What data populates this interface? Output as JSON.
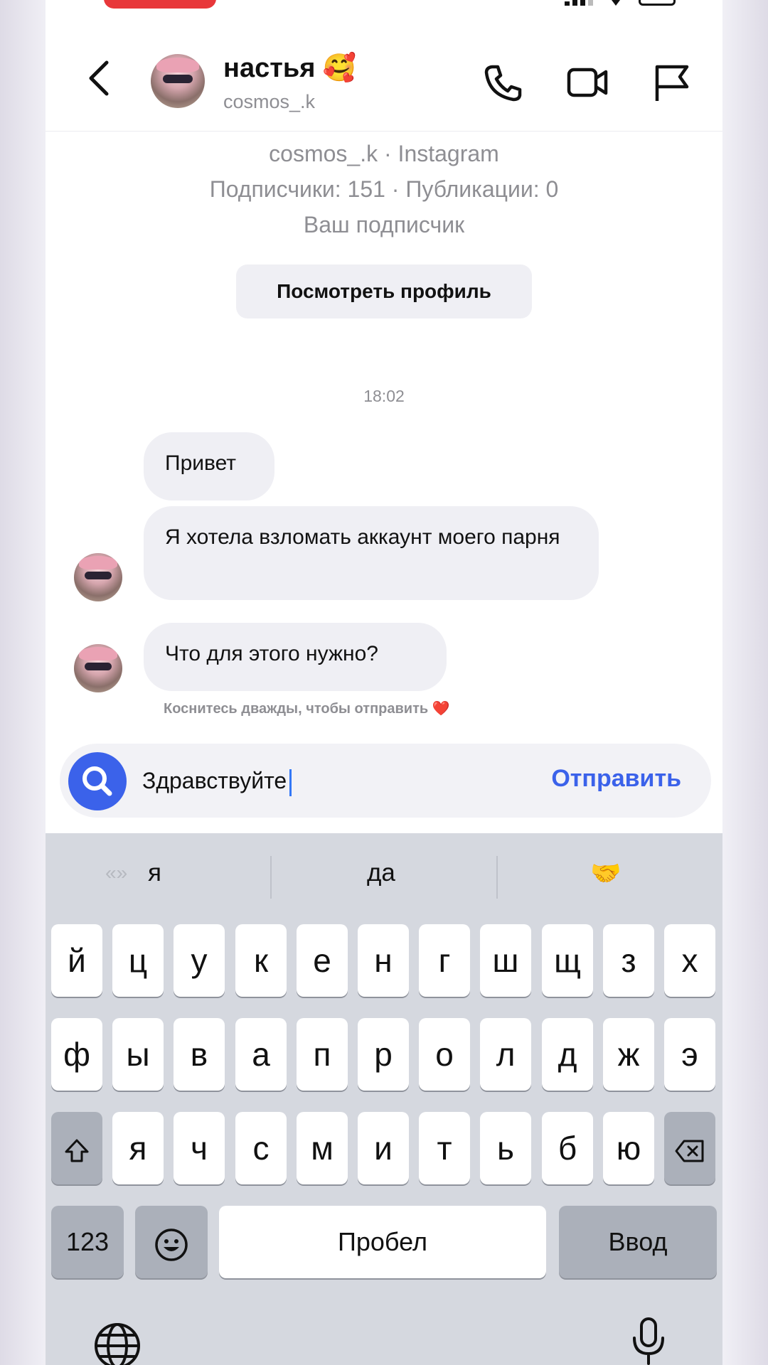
{
  "header": {
    "name": "настья 🥰",
    "username": "cosmos_.k"
  },
  "profile": {
    "line1": "cosmos_.k · Instagram",
    "line2": "Подписчики: 151 · Публикации: 0",
    "line3": "Ваш подписчик",
    "view_button": "Посмотреть профиль"
  },
  "chat": {
    "timestamp": "18:02",
    "messages": [
      {
        "text": "Привет"
      },
      {
        "text": "Я хотела взломать аккаунт моего парня"
      },
      {
        "text": "Что для этого нужно?"
      }
    ],
    "hint": "Коснитесь дважды, чтобы отправить ❤️"
  },
  "composer": {
    "value": "Здравствуйте",
    "send_label": "Отправить"
  },
  "keyboard": {
    "suggestions": [
      "я",
      "да",
      "🤝"
    ],
    "row1": [
      "й",
      "ц",
      "у",
      "к",
      "е",
      "н",
      "г",
      "ш",
      "щ",
      "з",
      "х"
    ],
    "row2": [
      "ф",
      "ы",
      "в",
      "а",
      "п",
      "р",
      "о",
      "л",
      "д",
      "ж",
      "э"
    ],
    "row3": [
      "я",
      "ч",
      "с",
      "м",
      "и",
      "т",
      "ь",
      "б",
      "ю"
    ],
    "numbers_label": "123",
    "space_label": "Пробел",
    "return_label": "Ввод"
  },
  "colors": {
    "accent": "#3b62ea",
    "bubble": "#efeff4",
    "keyboard_bg": "#d5d8df"
  }
}
